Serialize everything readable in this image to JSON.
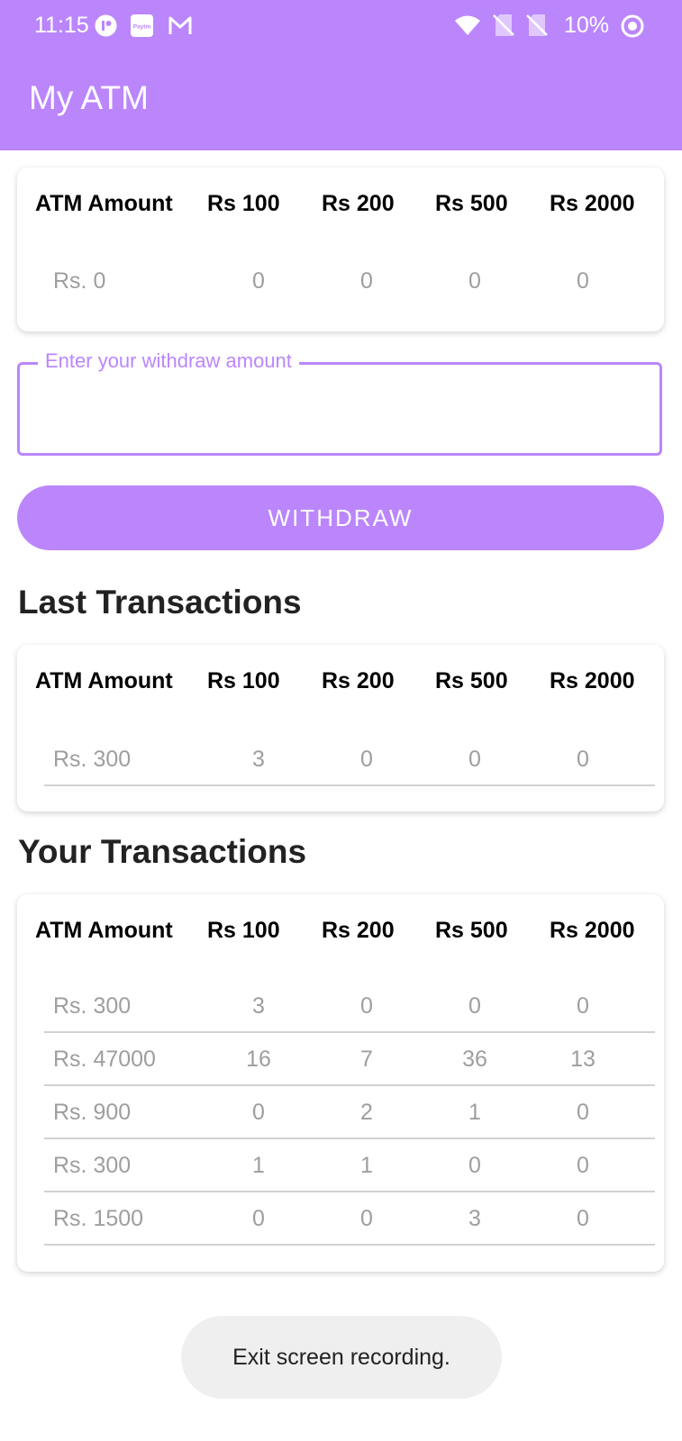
{
  "status_bar": {
    "time": "11:15",
    "app_icons": [
      "chat-app-icon",
      "paytm-icon",
      "gmail-icon"
    ],
    "paytm_label": "Paytm",
    "battery": "10%"
  },
  "app_bar": {
    "title": "My ATM"
  },
  "columns": [
    "ATM Amount",
    "Rs 100",
    "Rs 200",
    "Rs 500",
    "Rs 2000"
  ],
  "atm_balance": {
    "amount": "Rs. 0",
    "n100": "0",
    "n200": "0",
    "n500": "0",
    "n2000": "0"
  },
  "withdraw": {
    "label": "Enter your withdraw amount",
    "value": "",
    "button": "WITHDRAW"
  },
  "last_transactions": {
    "title": "Last Transactions",
    "rows": [
      {
        "amount": "Rs. 300",
        "n100": "3",
        "n200": "0",
        "n500": "0",
        "n2000": "0"
      }
    ]
  },
  "your_transactions": {
    "title": "Your Transactions",
    "rows": [
      {
        "amount": "Rs. 300",
        "n100": "3",
        "n200": "0",
        "n500": "0",
        "n2000": "0"
      },
      {
        "amount": "Rs. 47000",
        "n100": "16",
        "n200": "7",
        "n500": "36",
        "n2000": "13"
      },
      {
        "amount": "Rs. 900",
        "n100": "0",
        "n200": "2",
        "n500": "1",
        "n2000": "0"
      },
      {
        "amount": "Rs. 300",
        "n100": "1",
        "n200": "1",
        "n500": "0",
        "n2000": "0"
      },
      {
        "amount": "Rs. 1500",
        "n100": "0",
        "n200": "0",
        "n500": "3",
        "n2000": "0"
      }
    ]
  },
  "toast": {
    "text": "Exit screen recording."
  },
  "colors": {
    "accent": "#bb86fc",
    "muted_text": "#9e9e9e"
  }
}
